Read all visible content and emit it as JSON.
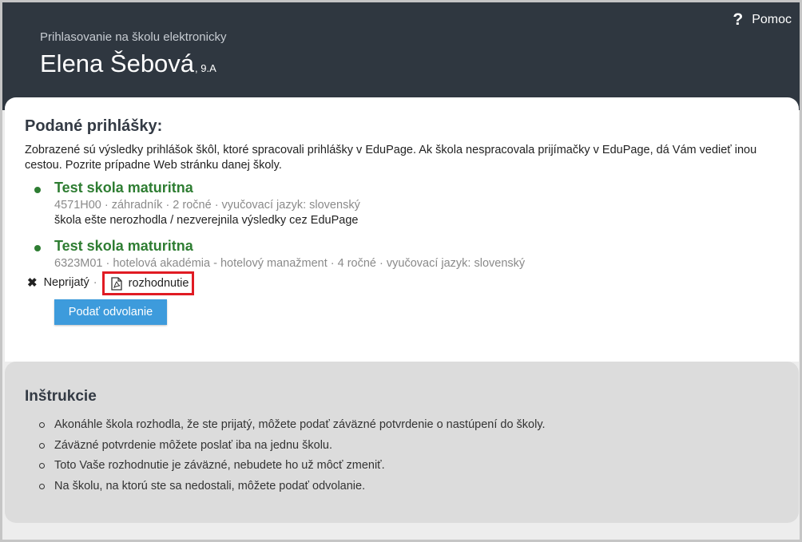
{
  "header": {
    "subtitle": "Prihlasovanie na školu elektronicky",
    "student_name": "Elena Šebová",
    "student_class": ", 9.A",
    "help_icon": "?",
    "help_label": "Pomoc"
  },
  "applications": {
    "title": "Podané prihlášky:",
    "intro": "Zobrazené sú výsledky prihlášok škôl, ktoré spracovali prihlášky v EduPage. Ak škola nespracovala prijímačky v EduPage, dá Vám vedieť inou cestou. Pozrite prípadne Web stránku danej školy.",
    "items": [
      {
        "school": "Test skola maturitna",
        "meta": "4571H00 · záhradník · 2 ročné · vyučovací jazyk: slovenský",
        "status": "škola ešte nerozhodla / nezverejnila výsledky cez EduPage"
      },
      {
        "school": "Test skola maturitna",
        "meta": "6323M01 · hotelová akadémia - hotelový manažment · 4 ročné · vyučovací jazyk: slovenský",
        "result_icon": "✖",
        "result_label": "Neprijatý",
        "separator": "·",
        "document_label": "rozhodnutie",
        "document_icon": "pdf-icon",
        "appeal_button": "Podať odvolanie"
      }
    ]
  },
  "instructions": {
    "title": "Inštrukcie",
    "items": [
      "Akonáhle škola rozhodla, že ste prijatý, môžete podať záväzné potvrdenie o nastúpení do školy.",
      "Záväzné potvrdenie môžete poslať iba na jednu školu.",
      "Toto Vaše rozhodnutie je záväzné, nebudete ho už môcť zmeniť.",
      "Na školu, na ktorú ste sa nedostali, môžete podať odvolanie."
    ]
  },
  "colors": {
    "header_bg": "#2f3740",
    "school_green": "#2e7d32",
    "button_blue": "#3d9bdc",
    "highlight_red": "#e01b23"
  }
}
